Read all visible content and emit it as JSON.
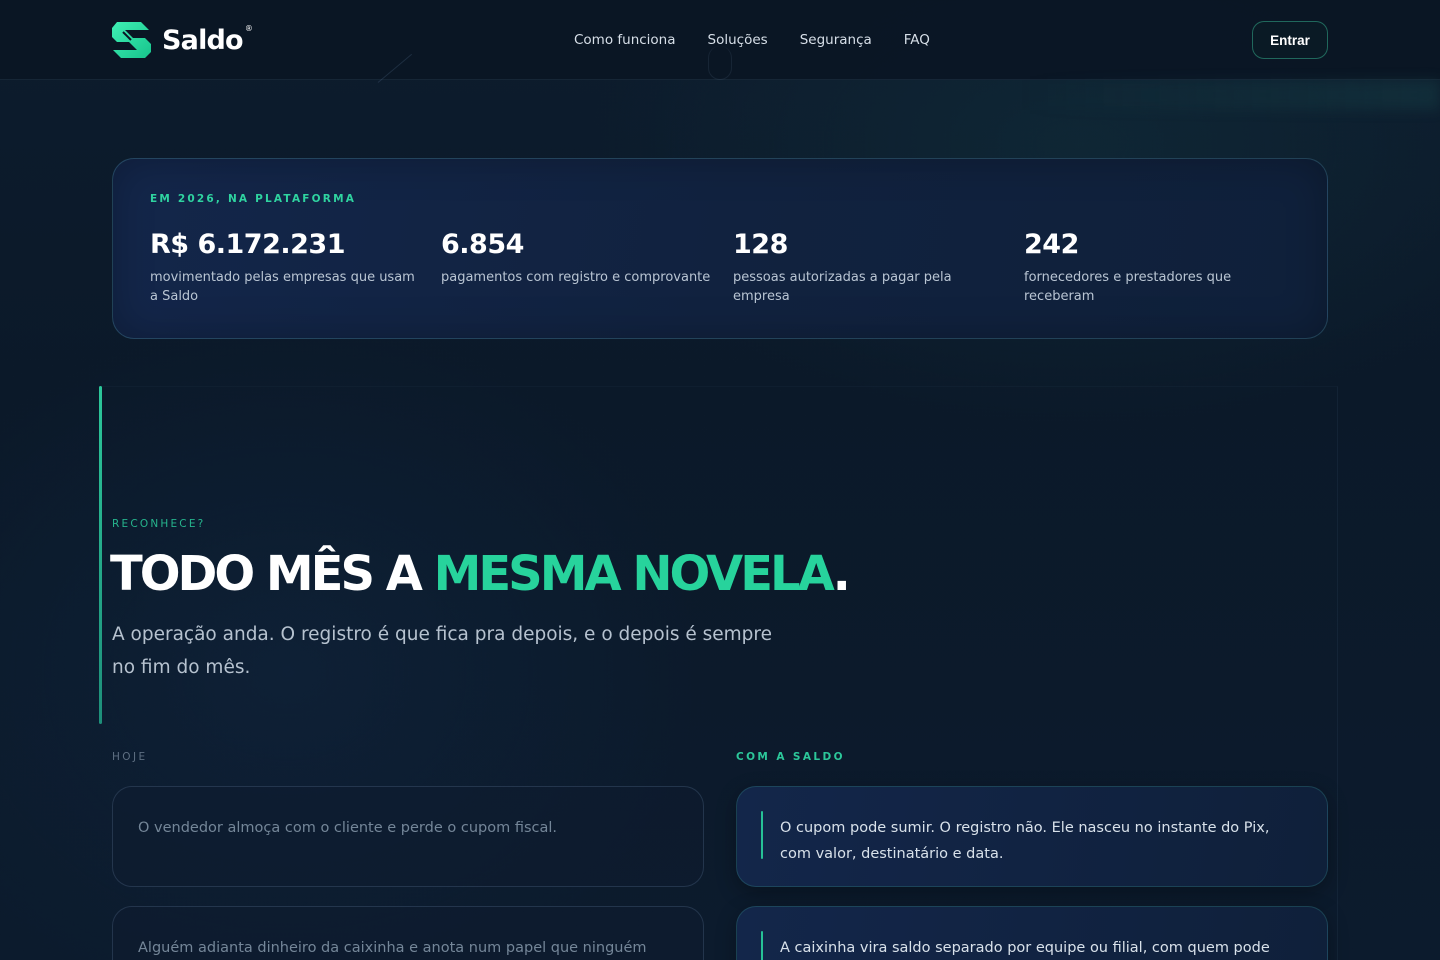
{
  "brand": {
    "name": "Saldo",
    "reg": "®",
    "accent_color": "#27d39c"
  },
  "nav": {
    "links": [
      "Como funciona",
      "Soluções",
      "Segurança",
      "FAQ"
    ],
    "cta_label": "Entrar"
  },
  "stats": {
    "eyebrow": "EM 2026, NA PLATAFORMA",
    "items": [
      {
        "value": "R$ 6.172.231",
        "label": "movimentado pelas empresas que usam a Saldo"
      },
      {
        "value": "6.854",
        "label": "pagamentos com registro e comprovante"
      },
      {
        "value": "128",
        "label": "pessoas autorizadas a pagar pela empresa"
      },
      {
        "value": "242",
        "label": "fornecedores e prestadores que receberam"
      }
    ]
  },
  "problem": {
    "eyebrow": "RECONHECE?",
    "headline_start": "TODO MÊS A ",
    "headline_accent": "MESMA NOVELA",
    "headline_end": ".",
    "lead": "A operação anda. O registro é que fica pra depois, e o depois é sempre no fim do mês.",
    "today_label": "HOJE",
    "saldo_label": "COM A SALDO",
    "today_cards": [
      "O vendedor almoça com o cliente e perde o cupom fiscal.",
      "Alguém adianta dinheiro da caixinha e anota num papel que ninguém"
    ],
    "saldo_cards": [
      "O cupom pode sumir. O registro não. Ele nasceu no instante do Pix, com valor, destinatário e data.",
      "A caixinha vira saldo separado por equipe ou filial, com quem pode"
    ]
  }
}
